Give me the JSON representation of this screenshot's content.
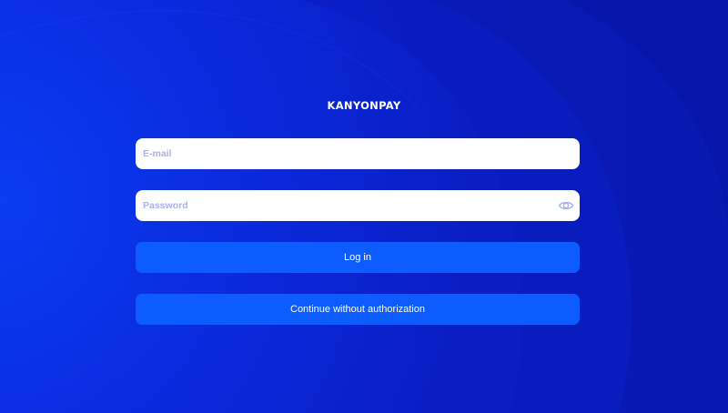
{
  "brand": {
    "name": "KANYONPAY"
  },
  "login_form": {
    "email_placeholder": "E-mail",
    "password_placeholder": "Password",
    "password_toggle_icon": "eye-icon",
    "login_label": "Log in",
    "guest_label": "Continue without authorization"
  },
  "colors": {
    "background": "#0a1fc8",
    "primary_button": "#0c5cff",
    "placeholder": "#a9b1e8"
  }
}
